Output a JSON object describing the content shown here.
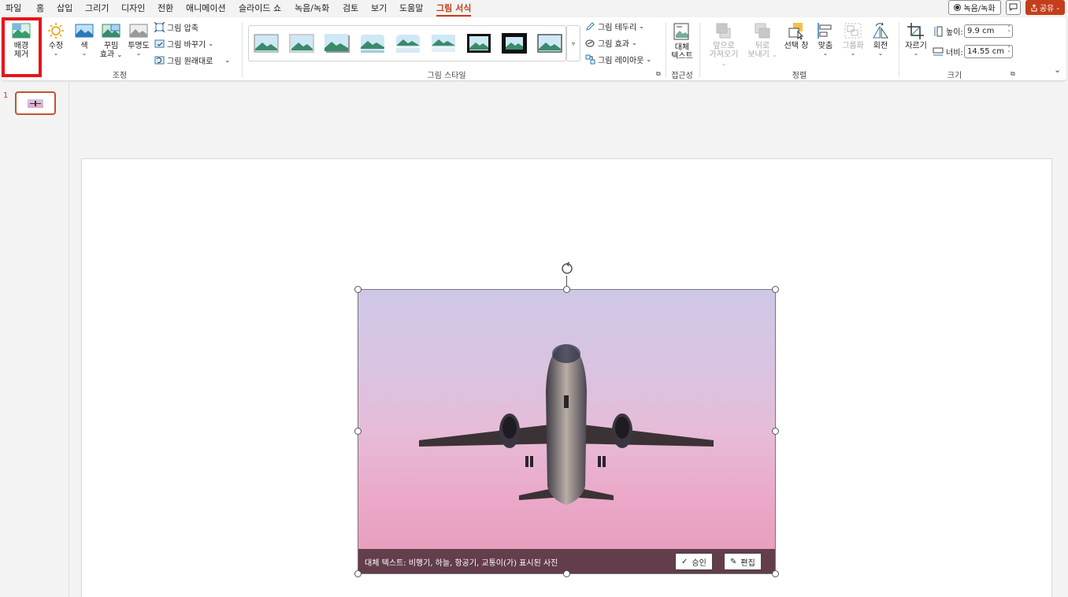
{
  "menu": {
    "tabs": [
      "파일",
      "홈",
      "삽입",
      "그리기",
      "디자인",
      "전환",
      "애니메이션",
      "슬라이드 쇼",
      "녹음/녹화",
      "검토",
      "보기",
      "도움말",
      "그림 서식"
    ],
    "active_tab": "그림 서식",
    "record_label": "녹음/녹화",
    "share_label": "공유"
  },
  "ribbon": {
    "adjust": {
      "remove_bg_line1": "배경",
      "remove_bg_line2": "제거",
      "corrections": "수정",
      "color": "색",
      "artistic_line1": "꾸밈",
      "artistic_line2": "효과",
      "transparency": "투명도",
      "compress": "그림 압축",
      "change": "그림 바꾸기",
      "reset": "그림 원래대로",
      "group_label": "조정"
    },
    "styles": {
      "border": "그림 테두리",
      "effects": "그림 효과",
      "layout": "그림 레이아웃",
      "group_label": "그림 스타일"
    },
    "accessibility": {
      "alt_line1": "대체",
      "alt_line2": "텍스트",
      "group_label": "접근성"
    },
    "arrange": {
      "forward_line1": "앞으로",
      "forward_line2": "가져오기",
      "backward_line1": "뒤로",
      "backward_line2": "보내기",
      "selection_pane": "선택 창",
      "align": "맞춤",
      "group": "그룹화",
      "rotate": "회전",
      "group_label": "정렬"
    },
    "size": {
      "crop": "자르기",
      "height_label": "높이:",
      "height_value": "9.9 cm",
      "width_label": "너비:",
      "width_value": "14.55 cm",
      "group_label": "크기"
    }
  },
  "slides": {
    "current_number": "1"
  },
  "alt_text_bar": {
    "text": "대체 텍스트: 비행기, 하늘, 항공기, 교통이(가) 표시된 사진",
    "approve_label": "승인",
    "edit_label": "편집"
  },
  "colors": {
    "accent": "#c43e1c",
    "highlight": "#e8141a"
  }
}
